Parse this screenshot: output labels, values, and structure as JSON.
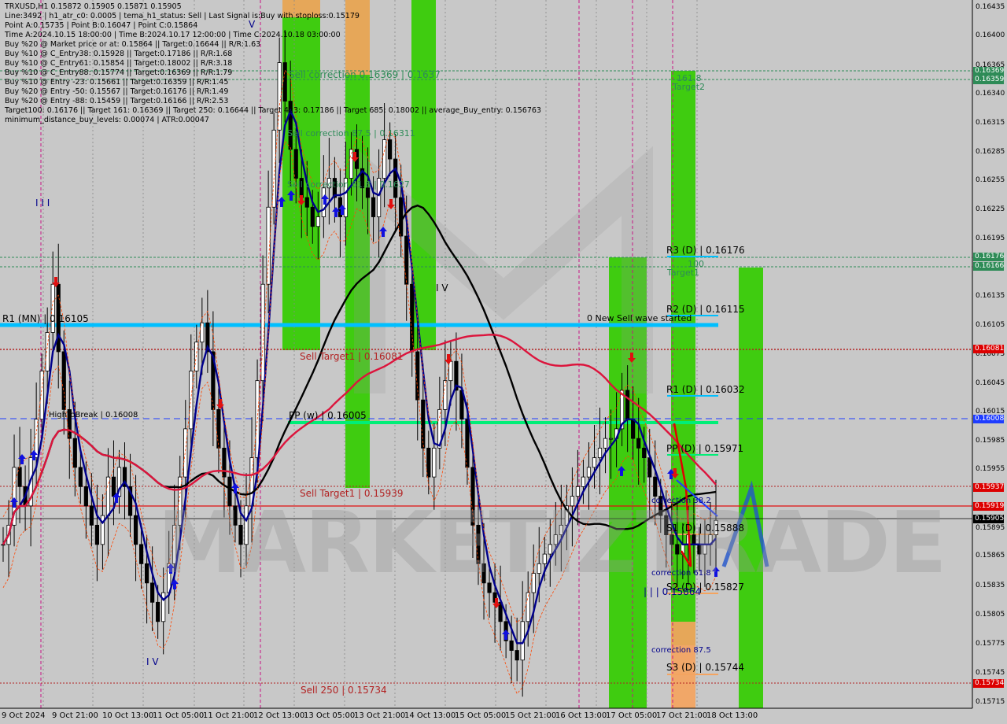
{
  "header": {
    "lines": [
      "TRXUSD,H1  0.15872 0.15905 0.15871 0.15905",
      "Line:3492 | h1_atr_c0: 0.0005 | tema_h1_status: Sell | Last Signal is:Buy with stoploss:0.15179",
      "Point A:0.15735 | Point B:0.16047 | Point C:0.15864",
      "Time A:2024.10.15 18:00:00 | Time B:2024.10.17 12:00:00 | Time C:2024.10.18 03:00:00",
      "Buy %20 @ Market price or at: 0.15864 || Target:0.16644 || R/R:1.63",
      "Buy %10 @ C_Entry38: 0.15928 || Target:0.17186 || R/R:1.68",
      "Buy %10 @ C_Entry61: 0.15854 || Target:0.18002 || R/R:3.18",
      "Buy %10 @ C_Entry88: 0.15774 || Target:0.16369 || R/R:1.79",
      "Buy %10 @ Entry -23: 0.15661 || Target:0.16359 || R/R:1.45",
      "Buy %20 @ Entry -50: 0.15567 || Target:0.16176 || R/R:1.49",
      "Buy %20 @ Entry -88: 0.15459 || Target:0.16166 || R/R:2.53",
      "Target100: 0.16176 || Target 161: 0.16369 || Target 250: 0.16644 || Target 423: 0.17186 || Target 685: 0.18002 || average_Buy_entry: 0.156763",
      "minimum_distance_buy_levels: 0.00074 | ATR:0.00047"
    ]
  },
  "watermark": "MARKETIZTRADE",
  "colors": {
    "background": "#c8c8c8",
    "green_zone": "#33cc00",
    "orange_zone": "#f4a460",
    "pivot_line": "#00bfff",
    "ema_black": "#000000",
    "ema_red": "#dc143c",
    "tema_blue": "#00008b",
    "support_label": "#00bfff",
    "price_tag": "#000000",
    "red_tag": "#dc0000",
    "green_tag": "#2e8b57",
    "pp_line": "#00ee77"
  },
  "y_axis": {
    "ticks": [
      "0.16435",
      "0.16400",
      "0.16365",
      "0.16340",
      "0.16315",
      "0.16285",
      "0.16255",
      "0.16225",
      "0.16195",
      "0.16135",
      "0.16105",
      "0.16075",
      "0.16045",
      "0.16015",
      "0.15985",
      "0.15955",
      "0.15895",
      "0.15865",
      "0.15835",
      "0.15805",
      "0.15775",
      "0.15745",
      "0.15715"
    ]
  },
  "x_axis": {
    "ticks": [
      "9 Oct 2024",
      "9 Oct 21:00",
      "10 Oct 13:00",
      "11 Oct 05:00",
      "11 Oct 21:00",
      "12 Oct 13:00",
      "13 Oct 05:00",
      "13 Oct 21:00",
      "14 Oct 13:00",
      "15 Oct 05:00",
      "15 Oct 21:00",
      "16 Oct 13:00",
      "17 Oct 05:00",
      "17 Oct 21:00",
      "18 Oct 13:00"
    ]
  },
  "price_tags": [
    {
      "text": "0.16369",
      "kind": "green"
    },
    {
      "text": "0.16359",
      "kind": "green"
    },
    {
      "text": "0.16176",
      "kind": "green"
    },
    {
      "text": "0.16166",
      "kind": "green"
    },
    {
      "text": "0.16081",
      "kind": "red"
    },
    {
      "text": "0.16008",
      "kind": "blue"
    },
    {
      "text": "0.15937",
      "kind": "red"
    },
    {
      "text": "0.15919",
      "kind": "red"
    },
    {
      "text": "0.15905",
      "kind": "black"
    },
    {
      "text": "0.15734",
      "kind": "red"
    }
  ],
  "labels": {
    "r1_mn": "R1 (MN) | 0.16105",
    "high_to_break": "HighToBreak | 0.16008",
    "pp_w": "PP (w) | 0.16005",
    "new_sell_wave": "0 New Sell wave started",
    "r3_d": "R3 (D) | 0.16176",
    "r2_d": "R2 (D) | 0.16115",
    "r1_d": "R1 (D) | 0.16032",
    "pp_d": "PP (D) | 0.15971",
    "s1_d": "S1 (D) | 0.15888",
    "s2_d": "S2 (D) | 0.15827",
    "s3_d": "S3 (D) | 0.15744",
    "target1": "Target1",
    "target1_val": "100",
    "target2": "Target2",
    "target2_val": "161.8",
    "correction_382": "correction 38.2",
    "correction_618": "correction 61.8",
    "correction_875": "correction 87.5",
    "c_point": "| | | 0.15864",
    "sell_target_top": "Sell correction 0.16369 | 0.1637",
    "sell_correction_875": "Sell correction 87.5 | 0.16311",
    "sell_correction_618": "Sell correction 61.8 | 0.1627",
    "sell_target_mid": "Sell Target1 | 0.16081",
    "sell_target_low": "Sell Target1 | 0.15939",
    "sell_250": "Sell 250 | 0.15734",
    "iv_a": "I V",
    "iv_b": "I V",
    "iii": "I I I",
    "v_mark": "V"
  },
  "chart_data": {
    "type": "candlestick",
    "symbol": "TRXUSD",
    "timeframe": "H1",
    "ylim": [
      0.1571,
      0.16445
    ],
    "last_price": 0.15905,
    "ohlc_last": {
      "open": 0.15872,
      "high": 0.15905,
      "low": 0.15871,
      "close": 0.15905
    },
    "horizontal_levels": [
      {
        "name": "R1 (MN)",
        "value": 0.16105
      },
      {
        "name": "HighToBreak",
        "value": 0.16008
      },
      {
        "name": "PP (w)",
        "value": 0.16005
      },
      {
        "name": "R3 (D)",
        "value": 0.16176
      },
      {
        "name": "R2 (D)",
        "value": 0.16115
      },
      {
        "name": "R1 (D)",
        "value": 0.16032
      },
      {
        "name": "PP (D)",
        "value": 0.15971
      },
      {
        "name": "S1 (D)",
        "value": 0.15888
      },
      {
        "name": "S2 (D)",
        "value": 0.15827
      },
      {
        "name": "S3 (D)",
        "value": 0.15744
      },
      {
        "name": "Target 161",
        "value": 0.16369
      },
      {
        "name": "Target 250",
        "value": 0.16359
      },
      {
        "name": "Target100",
        "value": 0.16176
      },
      {
        "name": "Target 88",
        "value": 0.16166
      },
      {
        "name": "Sell Target1",
        "value": 0.16081
      },
      {
        "name": "Sell Target1 (low)",
        "value": 0.15937
      },
      {
        "name": "Level",
        "value": 0.15919
      },
      {
        "name": "Sell 250",
        "value": 0.15734
      }
    ],
    "close_series": [
      0.1588,
      0.159,
      0.1596,
      0.1594,
      0.1592,
      0.1597,
      0.1601,
      0.1606,
      0.161,
      0.1615,
      0.1608,
      0.1602,
      0.1599,
      0.1596,
      0.1594,
      0.1592,
      0.159,
      0.1588,
      0.1591,
      0.1595,
      0.1593,
      0.1596,
      0.1594,
      0.1591,
      0.1588,
      0.1586,
      0.1584,
      0.1582,
      0.158,
      0.1583,
      0.1586,
      0.159,
      0.1595,
      0.16,
      0.1606,
      0.1609,
      0.1611,
      0.1608,
      0.1602,
      0.1598,
      0.1595,
      0.1592,
      0.159,
      0.1588,
      0.1592,
      0.1597,
      0.1605,
      0.1615,
      0.1623,
      0.1631,
      0.1638,
      0.1634,
      0.1629,
      0.1626,
      0.1624,
      0.1623,
      0.1621,
      0.1622,
      0.1625,
      0.1626,
      0.1624,
      0.1622,
      0.1626,
      0.1629,
      0.1627,
      0.1625,
      0.1624,
      0.1622,
      0.1626,
      0.163,
      0.1628,
      0.1624,
      0.162,
      0.1615,
      0.1608,
      0.1603,
      0.1598,
      0.1595,
      0.1598,
      0.1602,
      0.1605,
      0.1607,
      0.1604,
      0.1601,
      0.1596,
      0.159,
      0.1586,
      0.1584,
      0.1583,
      0.1582,
      0.158,
      0.1578,
      0.1577,
      0.1576,
      0.158,
      0.1583,
      0.1585,
      0.1586,
      0.1587,
      0.1588,
      0.1589,
      0.159,
      0.1592,
      0.1593,
      0.1594,
      0.1595,
      0.1596,
      0.1597,
      0.1598,
      0.1599,
      0.1599,
      0.16,
      0.1604,
      0.1601,
      0.1599,
      0.1598,
      0.1597,
      0.1595,
      0.1593,
      0.1591,
      0.1589,
      0.1588,
      0.1587,
      0.1588,
      0.1589,
      0.1588,
      0.1587,
      0.1588,
      0.1589,
      0.15905
    ]
  }
}
